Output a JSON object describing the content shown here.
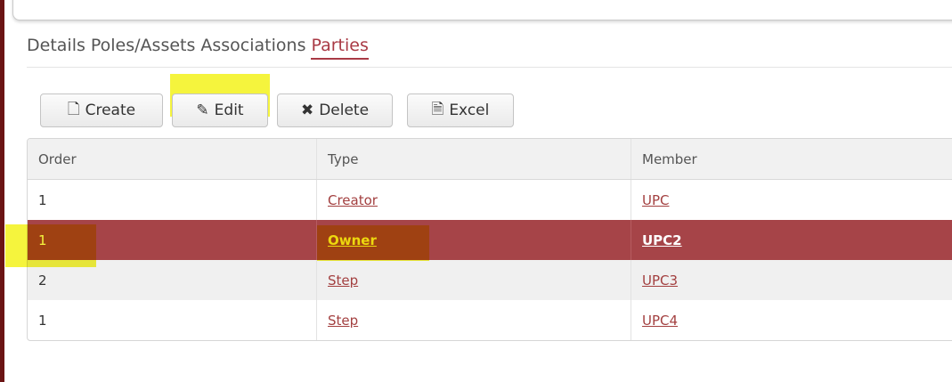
{
  "tabs": [
    {
      "label": "Details"
    },
    {
      "label": "Poles/Assets"
    },
    {
      "label": "Associations"
    },
    {
      "label": "Parties"
    }
  ],
  "active_tab": "Parties",
  "toolbar": {
    "create_label": "Create",
    "edit_label": "Edit",
    "delete_label": "Delete",
    "excel_label": "Excel"
  },
  "icons": {
    "create": "file-icon",
    "edit": "pencil-icon",
    "delete": "x-icon",
    "excel": "excel-file-icon"
  },
  "table": {
    "columns": [
      "Order",
      "Type",
      "Member"
    ],
    "rows": [
      {
        "order": "1",
        "type": "Creator",
        "member": "UPC"
      },
      {
        "order": "1",
        "type": "Owner",
        "member": "UPC2"
      },
      {
        "order": "2",
        "type": "Step",
        "member": "UPC3"
      },
      {
        "order": "1",
        "type": "Step",
        "member": "UPC4"
      }
    ],
    "selected_row": 2
  },
  "colors": {
    "accent": "#a93a45",
    "selected_row": "#a64448",
    "highlighter": "#f4f21a"
  }
}
